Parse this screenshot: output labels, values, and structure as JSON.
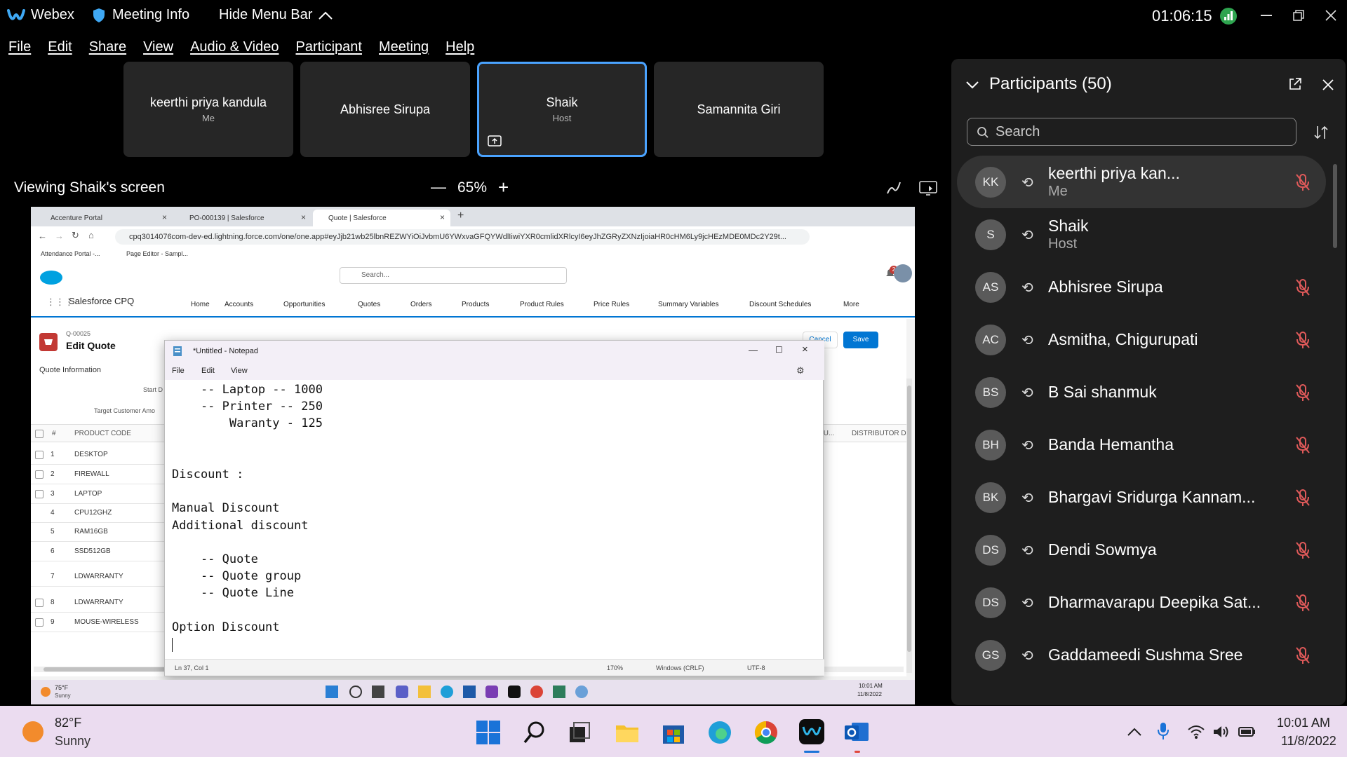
{
  "titlebar": {
    "app": "Webex",
    "meeting_info": "Meeting Info",
    "hide_menu": "Hide Menu Bar",
    "timer": "01:06:15"
  },
  "menu": [
    "File",
    "Edit",
    "Share",
    "View",
    "Audio & Video",
    "Participant",
    "Meeting",
    "Help"
  ],
  "tiles": [
    {
      "name": "keerthi priya kandula",
      "sub": "Me"
    },
    {
      "name": "Abhisree Sirupa",
      "sub": ""
    },
    {
      "name": "Shaik",
      "sub": "Host"
    },
    {
      "name": "Samannita Giri",
      "sub": ""
    }
  ],
  "viewing": {
    "label": "Viewing Shaik's screen",
    "zoom": "65%",
    "minus": "—",
    "plus": "+"
  },
  "browser": {
    "tabs": [
      "Accenture Portal",
      "PO-000139 | Salesforce",
      "Quote | Salesforce"
    ],
    "url": "cpq3014076com-dev-ed.lightning.force.com/one/one.app#eyJjb21wb25lbnREZWYiOiJvbmU6YWxvaGFQYWdlIiwiYXR0cmlidXRlcyI6eyJhZGRyZXNzIjoiaHR0cHM6Ly9jcHEzMDE0MDc2Y29t...",
    "bookmarks": [
      "Attendance Portal -...",
      "Page Editor - Sampl..."
    ]
  },
  "salesforce": {
    "search": "Search...",
    "app_name": "Salesforce CPQ",
    "nav": [
      "Home",
      "Accounts",
      "Opportunities",
      "Quotes",
      "Orders",
      "Products",
      "Product Rules",
      "Price Rules",
      "Summary Variables",
      "Discount Schedules",
      "More"
    ],
    "record_id": "Q-00025",
    "record_title": "Edit Quote",
    "cancel": "Cancel",
    "save": "Save",
    "section": "Quote Information",
    "field1": "Start D",
    "field2": "Target Customer Amo",
    "col_num": "#",
    "col_code": "PRODUCT CODE",
    "col_right1": "OU...",
    "col_right2": "DISTRIBUTOR D",
    "rows": [
      {
        "n": "1",
        "code": "DESKTOP"
      },
      {
        "n": "2",
        "code": "FIREWALL"
      },
      {
        "n": "3",
        "code": "LAPTOP"
      },
      {
        "n": "4",
        "code": "CPU12GHZ"
      },
      {
        "n": "5",
        "code": "RAM16GB"
      },
      {
        "n": "6",
        "code": "SSD512GB"
      },
      {
        "n": "7",
        "code": "LDWARRANTY"
      },
      {
        "n": "8",
        "code": "LDWARRANTY"
      },
      {
        "n": "9",
        "code": "MOUSE-WIRELESS"
      }
    ]
  },
  "notepad": {
    "title": "*Untitled - Notepad",
    "menu": [
      "File",
      "Edit",
      "View"
    ],
    "lines": [
      "    -- Laptop -- 1000",
      "    -- Printer -- 250",
      "        Waranty - 125",
      "",
      "",
      "Discount :",
      "",
      "Manual Discount",
      "Additional discount",
      "",
      "    -- Quote",
      "    -- Quote group",
      "    -- Quote Line",
      "",
      "Option Discount",
      ""
    ],
    "status_pos": "Ln 37, Col 1",
    "status_zoom": "170%",
    "status_eol": "Windows (CRLF)",
    "status_enc": "UTF-8"
  },
  "inner_taskbar": {
    "temp": "75°F",
    "weather": "Sunny",
    "time": "10:01 AM",
    "date": "11/8/2022"
  },
  "participants": {
    "title": "Participants (50)",
    "search_placeholder": "Search",
    "list": [
      {
        "initials": "KK",
        "name": "keerthi priya kan...",
        "sub": "Me",
        "muted": true,
        "me": true
      },
      {
        "initials": "S",
        "name": "Shaik",
        "sub": "Host",
        "muted": false,
        "me": false
      },
      {
        "initials": "AS",
        "name": "Abhisree Sirupa",
        "sub": "",
        "muted": true,
        "me": false
      },
      {
        "initials": "AC",
        "name": "Asmitha, Chigurupati",
        "sub": "",
        "muted": true,
        "me": false
      },
      {
        "initials": "BS",
        "name": "B Sai shanmuk",
        "sub": "",
        "muted": true,
        "me": false
      },
      {
        "initials": "BH",
        "name": "Banda Hemantha",
        "sub": "",
        "muted": true,
        "me": false
      },
      {
        "initials": "BK",
        "name": "Bhargavi Sridurga Kannam...",
        "sub": "",
        "muted": true,
        "me": false
      },
      {
        "initials": "DS",
        "name": "Dendi Sowmya",
        "sub": "",
        "muted": true,
        "me": false
      },
      {
        "initials": "DS",
        "name": "Dharmavarapu Deepika Sat...",
        "sub": "",
        "muted": true,
        "me": false
      },
      {
        "initials": "GS",
        "name": "Gaddameedi Sushma Sree",
        "sub": "",
        "muted": true,
        "me": false
      }
    ]
  },
  "taskbar": {
    "temp": "82°F",
    "weather": "Sunny",
    "time": "10:01 AM",
    "date": "11/8/2022"
  },
  "colors": {
    "accent": "#4aa3ff",
    "mute": "#e05a5a",
    "sf_blue": "#0176d3"
  }
}
